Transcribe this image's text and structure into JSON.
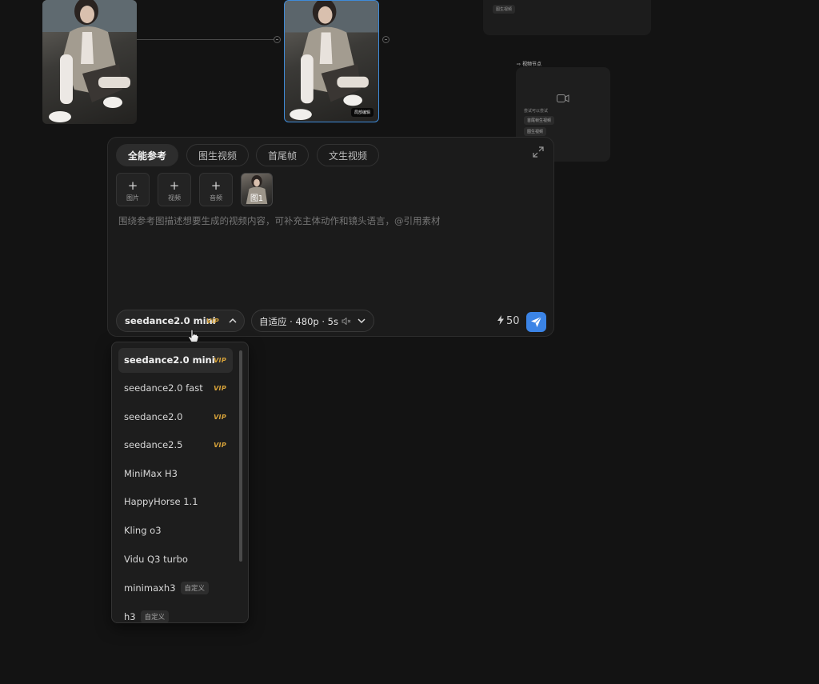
{
  "canvas": {
    "source_image": {
      "image_kind": "photo"
    },
    "output_image": {
      "edit_label": "局部编辑"
    },
    "ghost_card": {
      "chip_label": "图生视频"
    },
    "video_node": {
      "title": "视频节点",
      "hint": "尝试可以尝试",
      "chip1": "首尾帧生视频",
      "chip2": "图生视频"
    }
  },
  "panel": {
    "tabs": [
      "全能参考",
      "图生视频",
      "首尾帧",
      "文生视频"
    ],
    "active_tab": 0,
    "uploads": {
      "image": "图片",
      "video": "视频",
      "audio": "音频"
    },
    "reference": {
      "label": "图1"
    },
    "prompt": {
      "placeholder": "围绕参考图描述想要生成的视频内容，可补充主体动作和镜头语言，@引用素材",
      "value": ""
    },
    "model_select": {
      "value": "seedance2.0 mini",
      "badge": "VIP"
    },
    "settings_select": {
      "value": "自适应 · 480p · 5s"
    },
    "credits": "50"
  },
  "model_dropdown": {
    "items": [
      {
        "label": "seedance2.0 mini",
        "badge": "VIP",
        "tag": "",
        "selected": true
      },
      {
        "label": "seedance2.0 fast",
        "badge": "VIP",
        "tag": ""
      },
      {
        "label": "seedance2.0",
        "badge": "VIP",
        "tag": ""
      },
      {
        "label": "seedance2.5",
        "badge": "VIP",
        "tag": ""
      },
      {
        "label": "MiniMax H3",
        "badge": "",
        "tag": ""
      },
      {
        "label": "HappyHorse 1.1",
        "badge": "",
        "tag": ""
      },
      {
        "label": "Kling o3",
        "badge": "",
        "tag": ""
      },
      {
        "label": "Vidu Q3 turbo",
        "badge": "",
        "tag": ""
      },
      {
        "label": "minimaxh3",
        "badge": "",
        "tag": "自定义"
      },
      {
        "label": "h3",
        "badge": "",
        "tag": "自定义"
      }
    ]
  },
  "colors": {
    "background": "#131313",
    "panel": "#1b1b1b",
    "accent": "#3b84e6",
    "vip": "#d9a43a"
  }
}
